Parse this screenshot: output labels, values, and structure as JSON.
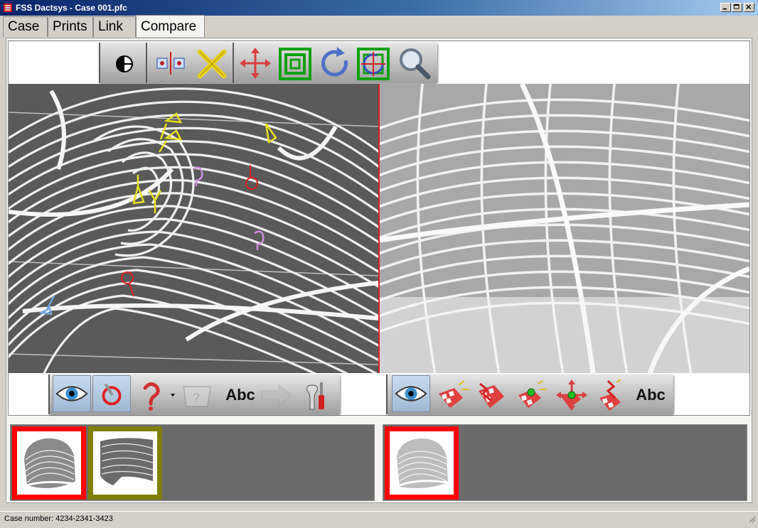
{
  "window": {
    "title": "FSS Dactsys - Case 001.pfc"
  },
  "tabs": [
    {
      "label": "Case"
    },
    {
      "label": "Prints"
    },
    {
      "label": "Link"
    },
    {
      "label": "Compare",
      "active": true
    }
  ],
  "left_tools": {
    "text_label": "Abc"
  },
  "right_tools": {
    "text_label": "Abc"
  },
  "status": {
    "text": "Case number: 4234-2341-3423"
  },
  "colors": {
    "active_thumb_border": "#ff0000",
    "secondary_thumb_border": "#808000",
    "divider": "#e02020"
  }
}
